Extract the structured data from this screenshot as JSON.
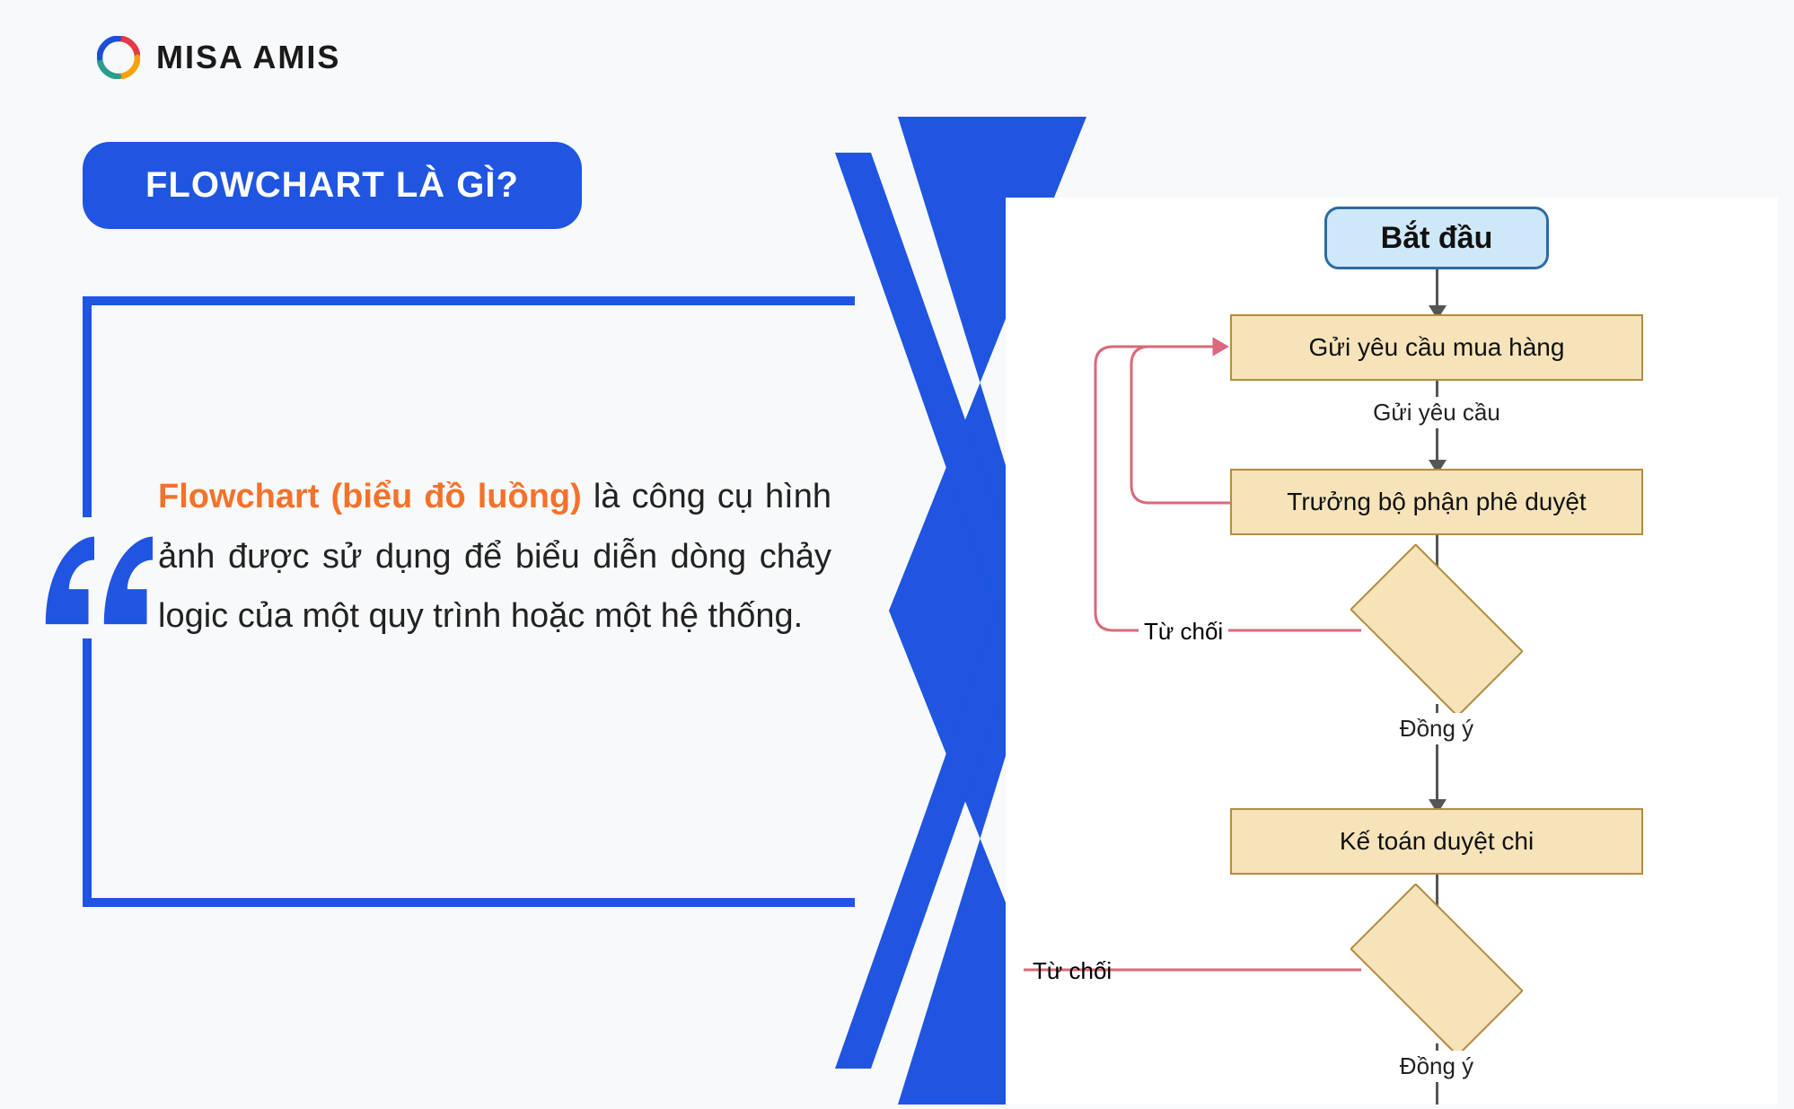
{
  "brand": {
    "name": "MISA AMIS"
  },
  "title": "FLOWCHART LÀ GÌ?",
  "quote": {
    "highlight": "Flowchart (biểu đồ luồng)",
    "rest": " là công cụ hình ảnh được sử dụng để biểu diễn dòng chảy logic của một quy trình hoặc một hệ thống."
  },
  "flowchart": {
    "start": "Bắt đầu",
    "steps": {
      "request": "Gửi yêu cầu mua hàng",
      "send_label": "Gửi yêu cầu",
      "approve_head": "Trưởng bộ phận phê duyệt",
      "reject1": "Từ chối",
      "agree1": "Đồng ý",
      "accountant": "Kế toán duyệt chi",
      "reject2": "Từ chối",
      "agree2": "Đồng ý"
    }
  },
  "colors": {
    "brand_blue": "#1f55e0",
    "accent_orange": "#f3722b",
    "node_fill": "#f6e3ba",
    "node_border": "#b28c3f",
    "start_fill": "#cfe8f7",
    "start_border": "#2d6aa3",
    "reject_line": "#d9697b"
  }
}
